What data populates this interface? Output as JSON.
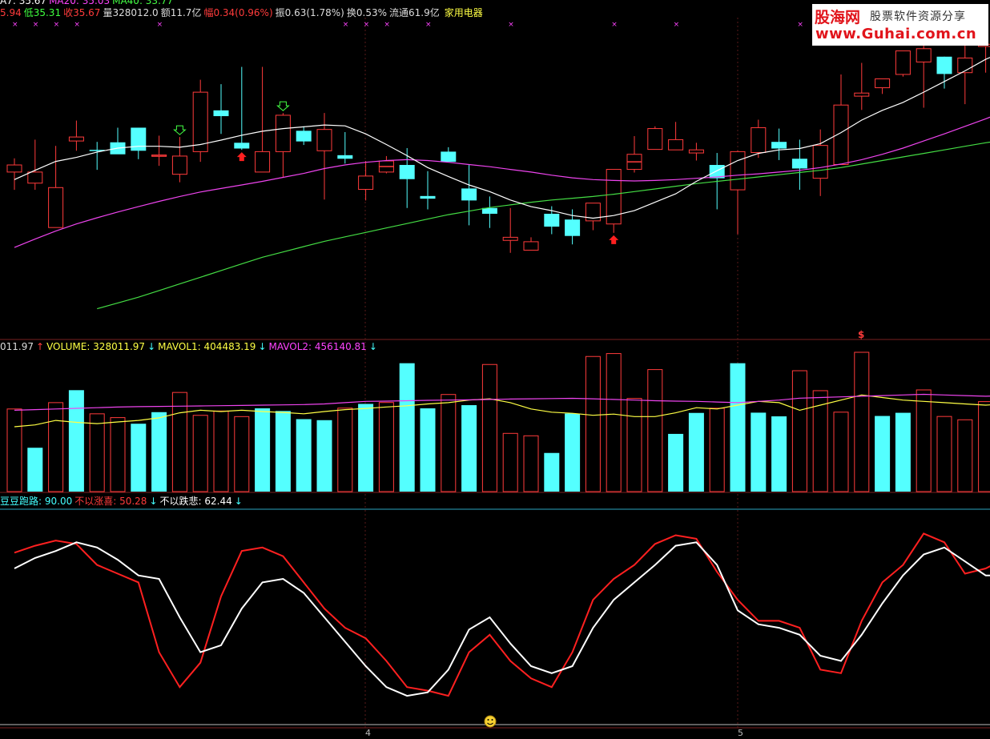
{
  "stock": {
    "name": "家用电器",
    "info": [
      {
        "text": "5.94",
        "color": "#ff3b3b"
      },
      {
        "text": "低35.31",
        "color": "#3fff3f"
      },
      {
        "text": "收35.67",
        "color": "#ff3b3b"
      },
      {
        "text": "量328012.0",
        "color": "#dcdcdc"
      },
      {
        "text": "额11.7亿",
        "color": "#dcdcdc"
      },
      {
        "text": "幅0.34(0.96%)",
        "color": "#ff3b3b"
      },
      {
        "text": "振0.63(1.78%)",
        "color": "#dcdcdc"
      },
      {
        "text": "换0.53%",
        "color": "#dcdcdc"
      },
      {
        "text": "流通61.9亿",
        "color": "#dcdcdc"
      }
    ],
    "ma_legend": [
      {
        "text": "A7: 35.67",
        "color": "#ffffff"
      },
      {
        "text": "MA20: 35.03",
        "color": "#ff44ff"
      },
      {
        "text": "MA40: 33.77",
        "color": "#44ff44"
      }
    ]
  },
  "volume_legend": [
    {
      "text": "011.97",
      "color": "#dcdcdc"
    },
    {
      "text": "↑",
      "color": "#ff3b3b"
    },
    {
      "text": "VOLUME: 328011.97",
      "color": "#ffff44"
    },
    {
      "text": "↓",
      "color": "#44ffff"
    },
    {
      "text": "MAVOL1: 404483.19",
      "color": "#ffff44"
    },
    {
      "text": "↓",
      "color": "#44ffff"
    },
    {
      "text": "MAVOL2: 456140.81",
      "color": "#ff44ff"
    },
    {
      "text": "↓",
      "color": "#44ffff"
    }
  ],
  "indicator_legend": [
    {
      "text": "豆豆跑路: 90.00",
      "color": "#44ffff"
    },
    {
      "text": "不以涨喜: 50.28",
      "color": "#ff3b3b"
    },
    {
      "text": "↓",
      "color": "#44ffff"
    },
    {
      "text": "不以跌悲: 62.44",
      "color": "#ffffff"
    },
    {
      "text": "↓",
      "color": "#44ffff"
    }
  ],
  "watermark": {
    "line1": "股海网",
    "line1b": "股票软件资源分享",
    "line2": "www.Guhai.com.cn"
  },
  "axis_labels": {
    "a": "4",
    "b": "5"
  },
  "chart_data": [
    {
      "type": "candlestick",
      "ylim": [
        33.0,
        40.0
      ],
      "candles": [
        [
          36.52,
          36.83,
          36.12,
          36.68
        ],
        [
          36.27,
          37.25,
          36.12,
          36.52
        ],
        [
          35.27,
          37.11,
          35.27,
          36.17
        ],
        [
          37.22,
          37.68,
          37.0,
          37.31
        ],
        [
          37.02,
          37.2,
          36.57,
          37.0
        ],
        [
          37.19,
          37.52,
          36.93,
          36.92
        ],
        [
          37.52,
          37.52,
          36.81,
          37.0
        ],
        [
          36.9,
          37.34,
          36.66,
          36.9
        ],
        [
          36.47,
          37.31,
          36.29,
          36.88
        ],
        [
          36.98,
          38.6,
          36.75,
          38.32
        ],
        [
          37.91,
          38.5,
          37.38,
          37.78
        ],
        [
          37.18,
          38.89,
          37.02,
          37.05
        ],
        [
          36.52,
          38.89,
          36.52,
          36.98
        ],
        [
          36.98,
          37.85,
          36.4,
          37.8
        ],
        [
          37.45,
          37.55,
          37.13,
          37.21
        ],
        [
          37.0,
          37.85,
          35.9,
          37.48
        ],
        [
          36.9,
          37.42,
          36.71,
          36.82
        ],
        [
          36.13,
          36.77,
          35.88,
          36.43
        ],
        [
          36.52,
          36.88,
          36.49,
          36.77
        ],
        [
          36.68,
          37.06,
          35.71,
          36.36
        ],
        [
          35.98,
          36.54,
          35.68,
          35.92
        ],
        [
          36.98,
          37.08,
          36.82,
          36.75
        ],
        [
          36.15,
          36.68,
          35.32,
          35.88
        ],
        [
          35.71,
          35.97,
          35.26,
          35.58
        ],
        [
          34.98,
          35.71,
          34.7,
          35.05
        ],
        [
          34.76,
          35.05,
          34.76,
          34.95
        ],
        [
          35.58,
          35.75,
          35.12,
          35.29
        ],
        [
          35.45,
          35.68,
          34.89,
          35.08
        ],
        [
          35.42,
          35.68,
          35.21,
          35.82
        ],
        [
          35.35,
          36.45,
          35.15,
          36.58
        ],
        [
          36.58,
          37.33,
          36.51,
          36.92
        ],
        [
          37.03,
          37.55,
          37.03,
          37.5
        ],
        [
          37.02,
          37.65,
          37.1,
          37.25
        ],
        [
          36.95,
          37.18,
          36.78,
          37.02
        ],
        [
          36.68,
          36.95,
          35.68,
          36.38
        ],
        [
          36.12,
          37.0,
          35.12,
          36.98
        ],
        [
          36.96,
          37.7,
          36.84,
          37.52
        ],
        [
          37.2,
          37.5,
          36.79,
          37.05
        ],
        [
          36.82,
          37.25,
          36.12,
          36.6
        ],
        [
          36.38,
          37.48,
          35.98,
          37.12
        ],
        [
          36.69,
          38.72,
          36.69,
          38.03
        ],
        [
          38.23,
          38.98,
          37.92,
          38.3
        ],
        [
          38.42,
          38.52,
          38.28,
          38.62
        ],
        [
          38.72,
          39.16,
          38.67,
          39.25
        ],
        [
          39.0,
          39.5,
          37.97,
          39.3
        ],
        [
          39.12,
          39.12,
          38.4,
          38.73
        ],
        [
          38.76,
          39.38,
          38.05,
          39.09
        ],
        [
          39.35,
          39.56,
          38.76,
          39.4
        ],
        [
          39.35,
          39.47,
          39.2,
          40.4
        ],
        [
          40.1,
          40.28,
          39.32,
          40.52
        ],
        [
          39.4,
          40.28,
          39.22,
          39.43
        ],
        [
          39.33,
          40.19,
          38.56,
          39.29
        ],
        [
          38.28,
          39.85,
          38.45,
          39.18
        ],
        [
          37.95,
          39.56,
          37.95,
          38.55
        ],
        [
          38.67,
          39.15,
          38.11,
          38.76
        ]
      ],
      "ma7": [
        36.35,
        36.56,
        36.76,
        36.85,
        36.97,
        37.06,
        37.1,
        37.1,
        37.08,
        37.14,
        37.24,
        37.35,
        37.44,
        37.5,
        37.54,
        37.58,
        37.56,
        37.38,
        37.14,
        36.89,
        36.62,
        36.42,
        36.23,
        36.08,
        35.89,
        35.74,
        35.65,
        35.54,
        35.48,
        35.54,
        35.65,
        35.84,
        36.03,
        36.31,
        36.55,
        36.78,
        36.94,
        37.02,
        37.05,
        37.16,
        37.41,
        37.69,
        37.91,
        38.09,
        38.32,
        38.56,
        38.8,
        39.06,
        39.26,
        39.35,
        39.36,
        39.28,
        39.2,
        39.08,
        39.0
      ],
      "ma20": [
        34.82,
        35.01,
        35.19,
        35.35,
        35.49,
        35.62,
        35.74,
        35.86,
        35.97,
        36.07,
        36.15,
        36.23,
        36.31,
        36.4,
        36.49,
        36.6,
        36.68,
        36.74,
        36.78,
        36.8,
        36.78,
        36.74,
        36.69,
        36.64,
        36.58,
        36.52,
        36.45,
        36.39,
        36.35,
        36.33,
        36.32,
        36.33,
        36.35,
        36.38,
        36.41,
        36.45,
        36.48,
        36.52,
        36.56,
        36.62,
        36.7,
        36.8,
        36.92,
        37.06,
        37.22,
        37.38,
        37.55,
        37.72,
        37.9,
        38.08,
        38.24,
        38.36,
        38.44,
        38.5,
        38.56
      ],
      "ma40": [
        null,
        null,
        null,
        null,
        33.44,
        33.57,
        33.7,
        33.85,
        34.0,
        34.15,
        34.3,
        34.45,
        34.6,
        34.72,
        34.84,
        34.96,
        35.06,
        35.16,
        35.26,
        35.36,
        35.46,
        35.56,
        35.64,
        35.72,
        35.78,
        35.84,
        35.89,
        35.93,
        35.97,
        36.02,
        36.08,
        36.14,
        36.2,
        36.26,
        36.31,
        36.36,
        36.41,
        36.46,
        36.51,
        36.56,
        36.62,
        36.7,
        36.78,
        36.86,
        36.94,
        37.02,
        37.1,
        37.18,
        37.25,
        37.32,
        37.38,
        37.44,
        37.5,
        37.55,
        37.6
      ],
      "markers": {
        "down_green": [
          8,
          13,
          54
        ],
        "up_red": [
          11,
          29
        ],
        "mid_ticks": [
          7,
          18,
          30
        ]
      }
    },
    {
      "type": "bar",
      "ylim": [
        0,
        800000
      ],
      "values": [
        650000,
        345000,
        700000,
        798000,
        612000,
        582000,
        534000,
        625000,
        780000,
        600000,
        634000,
        590000,
        655000,
        634000,
        570000,
        562000,
        657000,
        690000,
        701000,
        1010000,
        655000,
        764000,
        680000,
        1000000,
        458000,
        439000,
        304000,
        614000,
        1063000,
        1086000,
        733000,
        960000,
        454000,
        619000,
        656000,
        1010000,
        621000,
        592000,
        951000,
        794000,
        625000,
        1096000,
        595000,
        620000,
        800000,
        591000,
        565000,
        708000,
        725000,
        1012000,
        926000,
        920000,
        740000,
        711000,
        1004000
      ],
      "filled": [
        false,
        true,
        false,
        true,
        false,
        false,
        true,
        true,
        false,
        false,
        false,
        false,
        true,
        true,
        true,
        true,
        false,
        true,
        false,
        true,
        true,
        false,
        true,
        false,
        false,
        false,
        true,
        true,
        false,
        false,
        false,
        false,
        true,
        true,
        false,
        true,
        true,
        true,
        false,
        false,
        false,
        false,
        true,
        true,
        false,
        false,
        false,
        false,
        false,
        true,
        true,
        false,
        true,
        false,
        true
      ],
      "mavol1": [
        510000,
        525000,
        560000,
        545000,
        535000,
        548000,
        560000,
        580000,
        620000,
        640000,
        630000,
        640000,
        630000,
        623000,
        612000,
        630000,
        645000,
        654000,
        666000,
        675000,
        690000,
        700000,
        720000,
        730000,
        700000,
        650000,
        625000,
        616000,
        600000,
        610000,
        590000,
        590000,
        620000,
        660000,
        650000,
        680000,
        710000,
        700000,
        640000,
        680000,
        720000,
        760000,
        740000,
        720000,
        710000,
        700000,
        690000,
        680000,
        690000,
        680000,
        710000,
        720000,
        740000,
        790000,
        820000
      ],
      "mavol2": [
        640000,
        645000,
        650000,
        655000,
        660000,
        665000,
        668000,
        670000,
        672000,
        674000,
        676000,
        678000,
        680000,
        682000,
        685000,
        690000,
        700000,
        710000,
        712000,
        715000,
        718000,
        720000,
        722000,
        725000,
        728000,
        730000,
        732000,
        734000,
        730000,
        725000,
        720000,
        715000,
        712000,
        710000,
        705000,
        700000,
        710000,
        720000,
        735000,
        740000,
        745000,
        750000,
        755000,
        760000,
        765000,
        760000,
        755000,
        750000,
        755000,
        760000,
        765000,
        770000,
        775000,
        780000,
        785000
      ]
    },
    {
      "type": "line",
      "ylim": [
        0,
        100
      ],
      "series": [
        {
          "name": "不以涨喜",
          "color": "#ff2020",
          "values": [
            87,
            91,
            94,
            92,
            80,
            75,
            70,
            30,
            10,
            24,
            62,
            88,
            90,
            85,
            70,
            55,
            44,
            38,
            25,
            10,
            8,
            5,
            30,
            40,
            25,
            15,
            10,
            30,
            60,
            72,
            80,
            92,
            97,
            95,
            76,
            60,
            48,
            48,
            44,
            20,
            18,
            48,
            70,
            80,
            98,
            93,
            75,
            78,
            84,
            86,
            80,
            70,
            50,
            18,
            10
          ]
        },
        {
          "name": "不以跌悲",
          "color": "#ffffff",
          "values": [
            78,
            84,
            88,
            93,
            90,
            83,
            74,
            72,
            50,
            30,
            34,
            55,
            70,
            72,
            64,
            50,
            36,
            22,
            10,
            5,
            7,
            20,
            43,
            50,
            35,
            22,
            18,
            22,
            44,
            60,
            70,
            80,
            91,
            93,
            80,
            54,
            46,
            44,
            40,
            28,
            25,
            40,
            58,
            74,
            86,
            90,
            82,
            74,
            74,
            80,
            86,
            78,
            70,
            42,
            22
          ]
        }
      ]
    }
  ]
}
